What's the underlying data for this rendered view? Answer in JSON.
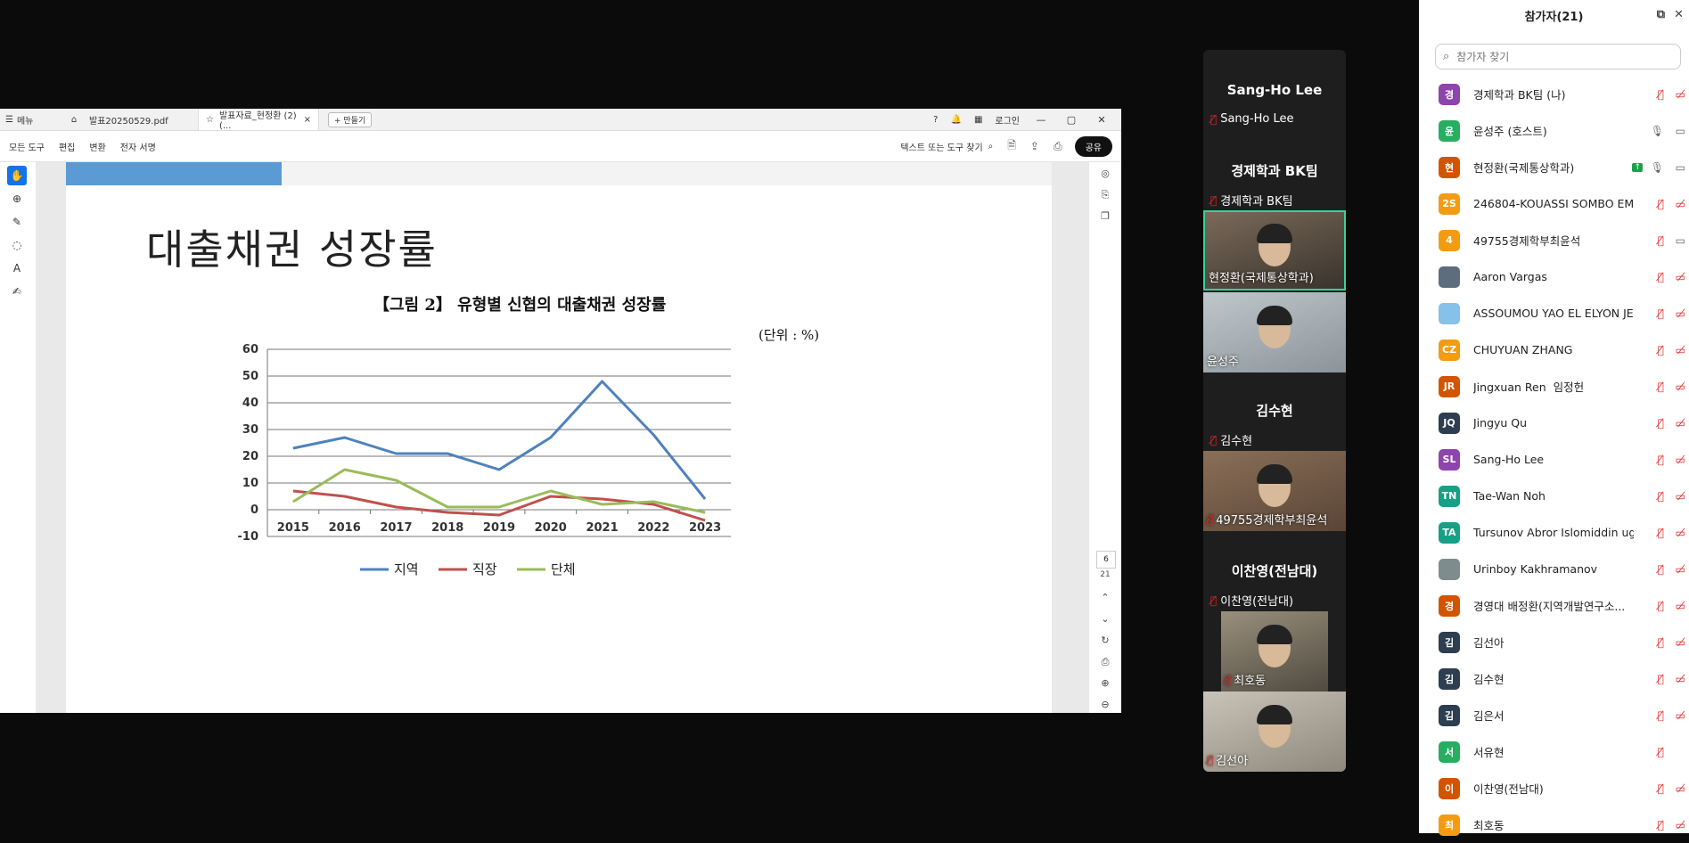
{
  "pdf": {
    "tabs": {
      "menu_label": "메뉴",
      "tab1_label": "발표20250529.pdf",
      "tab2_label": "발표자료_현정환 (2) (...",
      "new_tab_label": "+ 만들기",
      "login_label": "로그인"
    },
    "toolbar": {
      "all_tools": "모든 도구",
      "edit": "편집",
      "convert": "변환",
      "esign": "전자 서명",
      "find_text": "텍스트 또는 도구 찾기",
      "share": "공유"
    },
    "slide": {
      "title": "대출채권 성장률",
      "figure_caption": "【그림 2】 유형별 신협의 대출채권 성장률",
      "unit": "(단위 : %)"
    },
    "page_number": "6",
    "page_total": "21"
  },
  "chart_data": {
    "type": "line",
    "categories": [
      "2015",
      "2016",
      "2017",
      "2018",
      "2019",
      "2020",
      "2021",
      "2022",
      "2023"
    ],
    "series": [
      {
        "name": "지역",
        "color": "#4f81bd",
        "values": [
          23,
          27,
          21,
          21,
          15,
          27,
          48,
          28,
          4
        ]
      },
      {
        "name": "직장",
        "color": "#c0504d",
        "values": [
          7,
          5,
          1,
          -1,
          -2,
          5,
          4,
          2,
          -4
        ]
      },
      {
        "name": "단체",
        "color": "#9bbb59",
        "values": [
          3,
          15,
          11,
          1,
          1,
          7,
          2,
          3,
          -1
        ]
      }
    ],
    "ylim": [
      -10,
      60
    ],
    "yticks": [
      "60",
      "50",
      "40",
      "30",
      "20",
      "10",
      "0",
      "-10"
    ],
    "grid": true,
    "legend": "bottom"
  },
  "gallery": {
    "s1_name": "Sang-Ho Lee",
    "s1_sub": "Sang-Ho Lee",
    "s2_name": "경제학과 BK팀",
    "s2_sub": "경제학과 BK팀",
    "v1_label": "현정환(국제통상학과)",
    "v2_label": "윤성주",
    "s3_name": "김수현",
    "s3_sub": "김수현",
    "v3_label": "49755경제학부최윤석",
    "s4_name": "이찬영(전남대)",
    "s4_sub": "이찬영(전남대)",
    "v4_label": "최호동",
    "v5_label": "김선아"
  },
  "panel": {
    "title": "참가자(21)",
    "search_placeholder": "참가자 찾기",
    "participants": [
      {
        "initial": "경",
        "color": "#8e44ad",
        "name": "경제학과 BK팀 (나)"
      },
      {
        "initial": "윤",
        "color": "#27ae60",
        "name": "윤성주 (호스트)"
      },
      {
        "initial": "현",
        "color": "#d35400",
        "name": "현정환(국제통상학과)"
      },
      {
        "initial": "2S",
        "color": "#f39c12",
        "name": "246804-KOUASSI SOMBO EMM..."
      },
      {
        "initial": "4",
        "color": "#f39c12",
        "name": "49755경제학부최윤석"
      },
      {
        "initial": "",
        "color": "#5d6d7e",
        "name": "Aaron Vargas"
      },
      {
        "initial": "",
        "color": "#85c1e9",
        "name": "ASSOUMOU YAO EL ELYON JEA..."
      },
      {
        "initial": "CZ",
        "color": "#f39c12",
        "name": "CHUYUAN ZHANG"
      },
      {
        "initial": "JR",
        "color": "#d35400",
        "name": "Jingxuan Ren",
        "extra": "임정헌"
      },
      {
        "initial": "JQ",
        "color": "#2c3e50",
        "name": "Jingyu Qu"
      },
      {
        "initial": "SL",
        "color": "#8e44ad",
        "name": "Sang-Ho Lee"
      },
      {
        "initial": "TN",
        "color": "#16a085",
        "name": "Tae-Wan Noh"
      },
      {
        "initial": "TA",
        "color": "#16a085",
        "name": "Tursunov Abror Islomiddin ugli"
      },
      {
        "initial": "",
        "color": "#7f8c8d",
        "name": "Urinboy Kakhramanov"
      },
      {
        "initial": "경",
        "color": "#d35400",
        "name": "경영대 배정환(지역개발연구소..."
      },
      {
        "initial": "김",
        "color": "#2c3e50",
        "name": "김선아"
      },
      {
        "initial": "김",
        "color": "#2c3e50",
        "name": "김수현"
      },
      {
        "initial": "김",
        "color": "#2c3e50",
        "name": "김은서"
      },
      {
        "initial": "서",
        "color": "#27ae60",
        "name": "서유현"
      },
      {
        "initial": "이",
        "color": "#d35400",
        "name": "이찬영(전남대)"
      },
      {
        "initial": "최",
        "color": "#f39c12",
        "name": "최호동"
      }
    ]
  }
}
